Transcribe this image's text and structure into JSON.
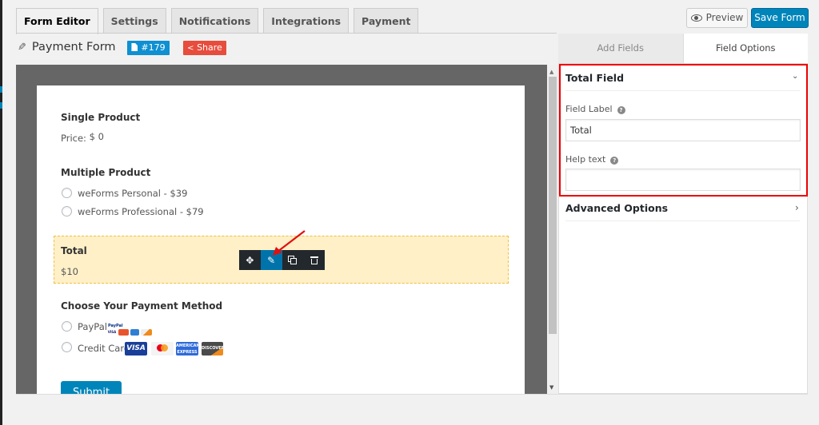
{
  "tabs": [
    {
      "label": "Form Editor",
      "active": true
    },
    {
      "label": "Settings",
      "active": false
    },
    {
      "label": "Notifications",
      "active": false
    },
    {
      "label": "Integrations",
      "active": false
    },
    {
      "label": "Payment",
      "active": false
    }
  ],
  "header": {
    "preview_label": "Preview",
    "save_label": "Save Form",
    "form_title": "Payment Form",
    "form_id": "#179",
    "share_label": "Share"
  },
  "form": {
    "single_product": {
      "label": "Single Product",
      "price_prefix": "Price:",
      "price": "$ 0"
    },
    "multiple_product": {
      "label": "Multiple Product",
      "options": [
        "weForms Personal - $39",
        "weForms Professional - $79"
      ]
    },
    "total": {
      "label": "Total",
      "value": "$10"
    },
    "payment_method": {
      "label": "Choose Your Payment Method",
      "options": [
        {
          "label": "PayPal",
          "logos": [
            "PayPal",
            "VISA",
            "MasterCard",
            "American Express",
            "Discover"
          ]
        },
        {
          "label": "Credit Card",
          "logos": [
            "VISA",
            "MasterCard",
            "American Express",
            "Discover"
          ]
        }
      ]
    },
    "submit_label": "Submit",
    "toolbar": {
      "icons": [
        "move-icon",
        "edit-icon",
        "duplicate-icon",
        "trash-icon"
      ],
      "active": "edit-icon"
    }
  },
  "panel": {
    "tabs": [
      {
        "label": "Add Fields",
        "active": false
      },
      {
        "label": "Field Options",
        "active": true
      }
    ],
    "section_title": "Total Field",
    "field_label_label": "Field Label",
    "field_label_value": "Total",
    "help_text_label": "Help text",
    "help_text_value": "",
    "advanced_options": "Advanced Options"
  },
  "colors": {
    "primary": "#0085ba",
    "share": "#e74c3c",
    "highlight_border": "#e00000",
    "selected_field_bg": "#fff0c8"
  }
}
